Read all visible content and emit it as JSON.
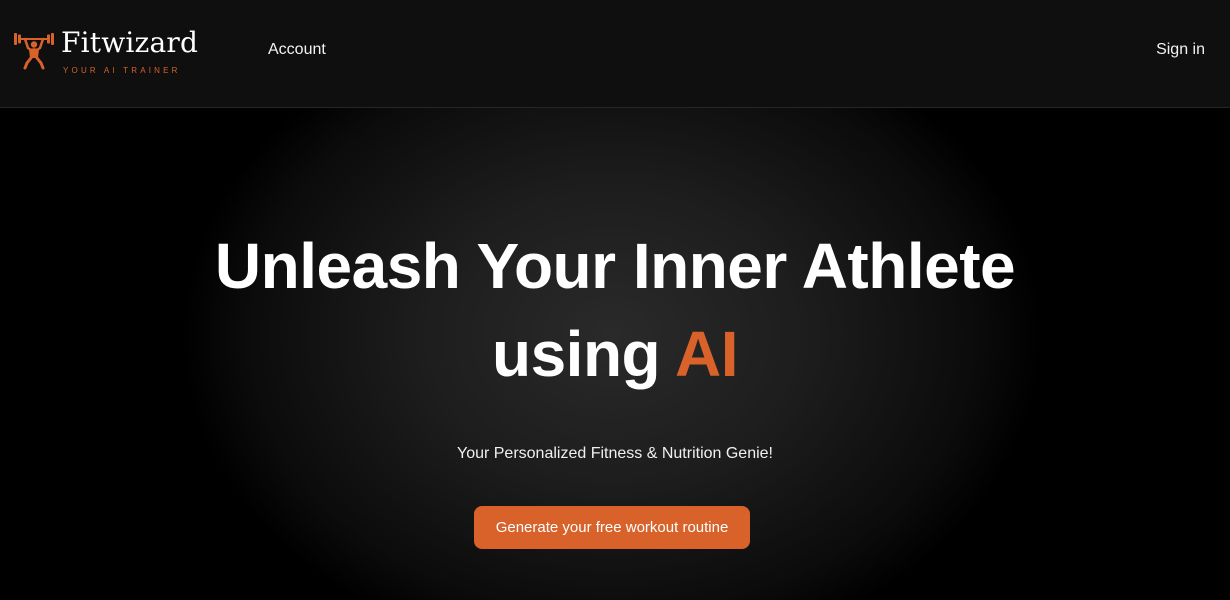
{
  "brand": {
    "name": "Fitwizard",
    "tagline": "YOUR AI TRAINER",
    "logo_icon": "weightlifter-icon",
    "accent_color": "#d8622a"
  },
  "nav": {
    "account_label": "Account",
    "signin_label": "Sign in"
  },
  "hero": {
    "title_line1": "Unleash Your Inner Athlete",
    "title_line2_plain": "using",
    "title_line2_accent": "AI",
    "subtitle": "Your Personalized Fitness & Nutrition Genie!",
    "cta_label": "Generate your free workout routine"
  }
}
